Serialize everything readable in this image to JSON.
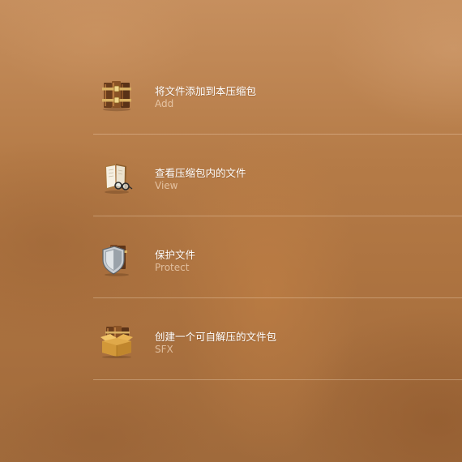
{
  "menu": {
    "items": [
      {
        "title": "将文件添加到本压缩包",
        "subtitle": "Add",
        "icon": "archive-books-icon"
      },
      {
        "title": "查看压缩包内的文件",
        "subtitle": "View",
        "icon": "open-book-glasses-icon"
      },
      {
        "title": "保护文件",
        "subtitle": "Protect",
        "icon": "shield-books-icon"
      },
      {
        "title": "创建一个可自解压的文件包",
        "subtitle": "SFX",
        "icon": "box-books-icon"
      }
    ]
  }
}
